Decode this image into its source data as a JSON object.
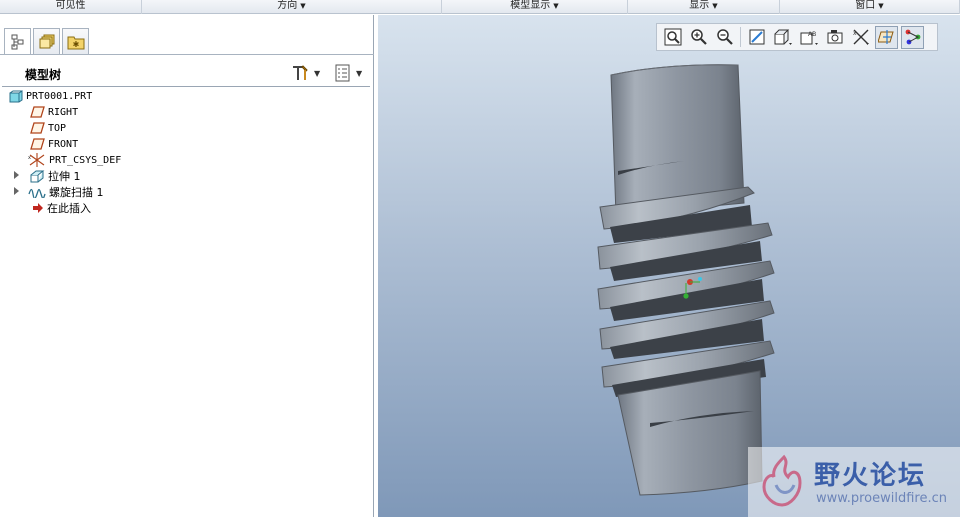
{
  "ribbon": {
    "groups": [
      {
        "label": "可见性",
        "dropdown": false
      },
      {
        "label": "方向",
        "dropdown": true
      },
      {
        "label": "模型显示",
        "dropdown": true
      },
      {
        "label": "显示",
        "dropdown": true
      },
      {
        "label": "窗口",
        "dropdown": true
      }
    ]
  },
  "left_panel": {
    "tabs": [
      "model-tree-tab",
      "layers-tab",
      "favorites-tab"
    ],
    "header": {
      "title": "模型树"
    },
    "tree": [
      {
        "label": "PRT0001.PRT",
        "icon": "part-icon",
        "expandable": false
      },
      {
        "label": "RIGHT",
        "icon": "datum-plane-icon",
        "expandable": false
      },
      {
        "label": "TOP",
        "icon": "datum-plane-icon",
        "expandable": false
      },
      {
        "label": "FRONT",
        "icon": "datum-plane-icon",
        "expandable": false
      },
      {
        "label": "PRT_CSYS_DEF",
        "icon": "csys-icon",
        "expandable": false
      },
      {
        "label": "拉伸 1",
        "icon": "extrude-icon",
        "expandable": true
      },
      {
        "label": "螺旋扫描 1",
        "icon": "helical-sweep-icon",
        "expandable": true
      },
      {
        "label": "在此插入",
        "icon": "insert-here-arrow-icon",
        "expandable": false
      }
    ]
  },
  "view_toolbar": {
    "buttons": [
      "refit-icon",
      "zoom-in-icon",
      "zoom-out-icon",
      "repaint-icon",
      "display-style-icon",
      "saved-orientations-icon",
      "view-manager-icon",
      "datum-display-icon",
      "spin-center-icon",
      "annotation-display-icon"
    ],
    "active": [
      "spin-center-icon",
      "annotation-display-icon"
    ]
  },
  "watermark": {
    "text": "野火论坛",
    "url": "www.proewildfire.cn"
  },
  "colors": {
    "viewport_top": "#d8e3ee",
    "viewport_bottom": "#7f98b8",
    "model_gray": "#9aa2ac",
    "watermark_blue": "#3b5fa9"
  }
}
